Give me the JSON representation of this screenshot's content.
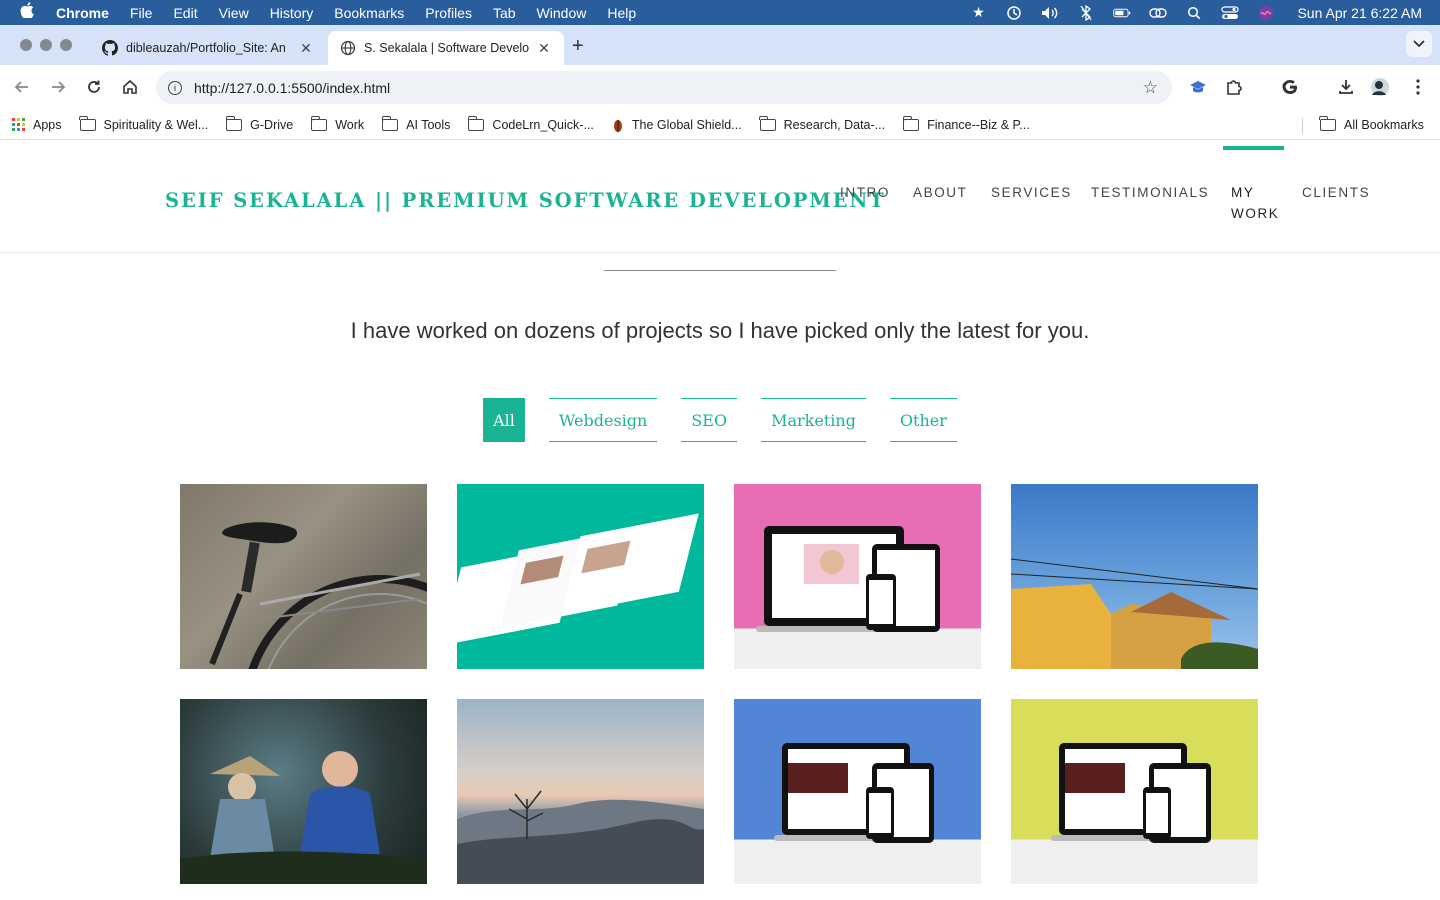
{
  "menubar": {
    "app_name": "Chrome",
    "items": [
      "File",
      "Edit",
      "View",
      "History",
      "Bookmarks",
      "Profiles",
      "Tab",
      "Window",
      "Help"
    ],
    "clock": "Sun Apr 21  6:22 AM"
  },
  "tabs": [
    {
      "title": "dibleauzah/Portfolio_Site: An",
      "active": false
    },
    {
      "title": "S. Sekalala | Software Develo",
      "active": true
    }
  ],
  "address": {
    "url": "http://127.0.0.1:5500/index.html"
  },
  "bookmarks": {
    "apps_label": "Apps",
    "items": [
      "Spirituality & Wel...",
      "G-Drive",
      "Work",
      "AI Tools",
      "CodeLrn_Quick-...",
      "The Global Shield...",
      "Research, Data-...",
      "Finance--Biz & P..."
    ],
    "all_bookmarks": "All Bookmarks"
  },
  "site": {
    "brand": "SEIF SEKALALA || PREMIUM SOFTWARE DEVELOPMENT",
    "nav": [
      "INTRO",
      "ABOUT",
      "SERVICES",
      "TESTIMONIALS",
      "MY",
      "WORK",
      "CLIENTS"
    ],
    "active_nav": "MY WORK",
    "lead": "I have worked on dozens of projects so I have picked only the latest for you.",
    "filters": [
      "All",
      "Webdesign",
      "SEO",
      "Marketing",
      "Other"
    ],
    "active_filter": "All",
    "portfolio": [
      "bicycle-photo",
      "webdesign-mockup",
      "responsive-mockup-pink",
      "yellow-wall-sky-photo",
      "figurines-photo",
      "mountain-sunrise-photo",
      "responsive-mockup-blue",
      "responsive-mockup-lime"
    ]
  },
  "colors": {
    "accent": "#1ab394",
    "menubar": "#2a5d9c",
    "tabstrip": "#d6e2f7"
  }
}
